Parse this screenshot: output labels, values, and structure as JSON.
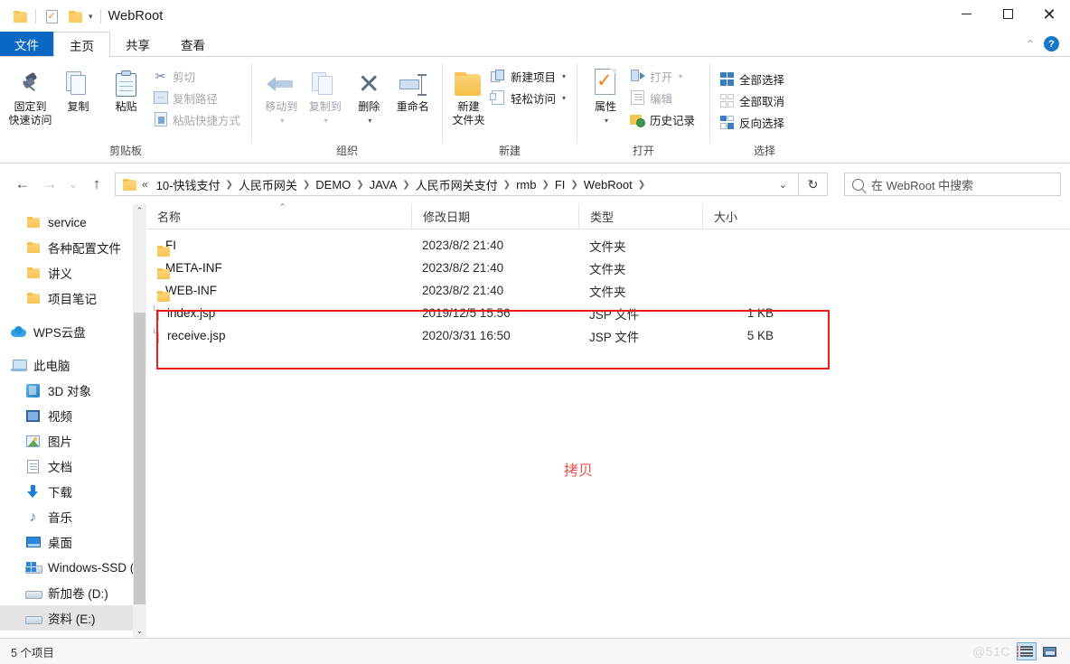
{
  "window": {
    "title": "WebRoot",
    "quick_access": [
      "folder-icon",
      "properties-icon",
      "new-folder-icon"
    ],
    "controls": {
      "minimize": "minimize-icon",
      "maximize": "maximize-icon",
      "close": "close-icon"
    }
  },
  "ribbon": {
    "tabs": [
      {
        "label": "文件",
        "kind": "file"
      },
      {
        "label": "主页",
        "kind": "active"
      },
      {
        "label": "共享",
        "kind": "normal"
      },
      {
        "label": "查看",
        "kind": "normal"
      }
    ],
    "collapse_icon": "chevron-up-icon",
    "help_icon": "help-icon",
    "groups": [
      {
        "caption": "剪贴板",
        "big": [
          {
            "label1": "固定到",
            "label2": "快速访问",
            "icon": "pin-icon"
          },
          {
            "label1": "复制",
            "label2": "",
            "icon": "copy-icon"
          },
          {
            "label1": "粘贴",
            "label2": "",
            "icon": "paste-icon"
          }
        ],
        "small": [
          {
            "label": "剪切",
            "icon": "scissors-icon",
            "dim": true
          },
          {
            "label": "复制路径",
            "icon": "copy-path-icon",
            "dim": true
          },
          {
            "label": "粘贴快捷方式",
            "icon": "paste-shortcut-icon",
            "dim": true
          }
        ]
      },
      {
        "caption": "组织",
        "big": [
          {
            "label1": "移动到",
            "label2": "",
            "icon": "move-to-icon",
            "caret": true,
            "dim": true
          },
          {
            "label1": "复制到",
            "label2": "",
            "icon": "copy-to-icon",
            "caret": true,
            "dim": true
          },
          {
            "label1": "删除",
            "label2": "",
            "icon": "delete-icon",
            "caret": true
          },
          {
            "label1": "重命名",
            "label2": "",
            "icon": "rename-icon"
          }
        ]
      },
      {
        "caption": "新建",
        "big": [
          {
            "label1": "新建",
            "label2": "文件夹",
            "icon": "new-folder-icon"
          }
        ],
        "small": [
          {
            "label": "新建项目",
            "icon": "new-item-icon",
            "caret": true
          },
          {
            "label": "轻松访问",
            "icon": "easy-access-icon",
            "caret": true
          }
        ]
      },
      {
        "caption": "打开",
        "big": [
          {
            "label1": "属性",
            "label2": "",
            "icon": "properties-icon",
            "caret": true
          }
        ],
        "small": [
          {
            "label": "打开",
            "icon": "open-icon",
            "caret": true,
            "dim": true
          },
          {
            "label": "编辑",
            "icon": "edit-icon",
            "dim": true
          },
          {
            "label": "历史记录",
            "icon": "history-icon"
          }
        ]
      },
      {
        "caption": "选择",
        "small": [
          {
            "label": "全部选择",
            "icon": "select-all-icon"
          },
          {
            "label": "全部取消",
            "icon": "select-none-icon"
          },
          {
            "label": "反向选择",
            "icon": "invert-selection-icon"
          }
        ]
      }
    ]
  },
  "address": {
    "back_icon": "back-arrow-icon",
    "forward_icon": "forward-arrow-icon",
    "recent_icon": "chevron-down-icon",
    "up_icon": "up-arrow-icon",
    "overflow": "«",
    "crumbs": [
      "10-快钱支付",
      "人民币网关",
      "DEMO",
      "JAVA",
      "人民币网关支付",
      "rmb",
      "FI",
      "WebRoot"
    ],
    "trailing_sep": ">",
    "dropdown_icon": "chevron-down-icon",
    "refresh_icon": "refresh-icon",
    "search_placeholder": "在 WebRoot 中搜索",
    "search_value": ""
  },
  "sidebar": {
    "groups": [
      {
        "items": [
          {
            "label": "service",
            "icon": "folder-icon",
            "level": 2
          },
          {
            "label": "各种配置文件",
            "icon": "folder-icon",
            "level": 2
          },
          {
            "label": "讲义",
            "icon": "folder-icon",
            "level": 2
          },
          {
            "label": "项目笔记",
            "icon": "folder-icon",
            "level": 2
          }
        ]
      },
      {
        "items": [
          {
            "label": "WPS云盘",
            "icon": "cloud-icon",
            "level": 1
          }
        ]
      },
      {
        "items": [
          {
            "label": "此电脑",
            "icon": "this-pc-icon",
            "level": 1
          },
          {
            "label": "3D 对象",
            "icon": "3d-objects-icon",
            "level": 2
          },
          {
            "label": "视频",
            "icon": "videos-icon",
            "level": 2
          },
          {
            "label": "图片",
            "icon": "pictures-icon",
            "level": 2
          },
          {
            "label": "文档",
            "icon": "documents-icon",
            "level": 2
          },
          {
            "label": "下载",
            "icon": "downloads-icon",
            "level": 2
          },
          {
            "label": "音乐",
            "icon": "music-icon",
            "level": 2
          },
          {
            "label": "桌面",
            "icon": "desktop-icon",
            "level": 2
          },
          {
            "label": "Windows-SSD (",
            "icon": "windows-drive-icon",
            "level": 2
          },
          {
            "label": "新加卷 (D:)",
            "icon": "drive-icon",
            "level": 2
          },
          {
            "label": "资料 (E:)",
            "icon": "drive-icon",
            "level": 2,
            "selected": true
          }
        ]
      }
    ],
    "scroll_up_icon": "chevron-up-icon",
    "scroll_down_icon": "chevron-down-icon"
  },
  "filelist": {
    "columns": [
      {
        "key": "name",
        "label": "名称",
        "sorted": true,
        "sort_icon": "sort-asc-icon"
      },
      {
        "key": "date",
        "label": "修改日期"
      },
      {
        "key": "type",
        "label": "类型"
      },
      {
        "key": "size",
        "label": "大小"
      }
    ],
    "rows": [
      {
        "name": "FI",
        "date": "2023/8/2 21:40",
        "type": "文件夹",
        "size": "",
        "icon": "folder-icon"
      },
      {
        "name": "META-INF",
        "date": "2023/8/2 21:40",
        "type": "文件夹",
        "size": "",
        "icon": "folder-icon"
      },
      {
        "name": "WEB-INF",
        "date": "2023/8/2 21:40",
        "type": "文件夹",
        "size": "",
        "icon": "folder-icon"
      },
      {
        "name": "index.jsp",
        "date": "2019/12/5 15:56",
        "type": "JSP 文件",
        "size": "1 KB",
        "icon": "file-icon"
      },
      {
        "name": "receive.jsp",
        "date": "2020/3/31 16:50",
        "type": "JSP 文件",
        "size": "5 KB",
        "icon": "file-icon"
      }
    ],
    "annotation": {
      "text": "拷贝",
      "color": "#f0534f"
    },
    "highlight_color": "#e8201c"
  },
  "statusbar": {
    "item_count": "5 个项目",
    "watermark": "@51C",
    "views": [
      {
        "name": "details-view",
        "active": true
      },
      {
        "name": "large-icons-view",
        "active": false
      }
    ]
  }
}
